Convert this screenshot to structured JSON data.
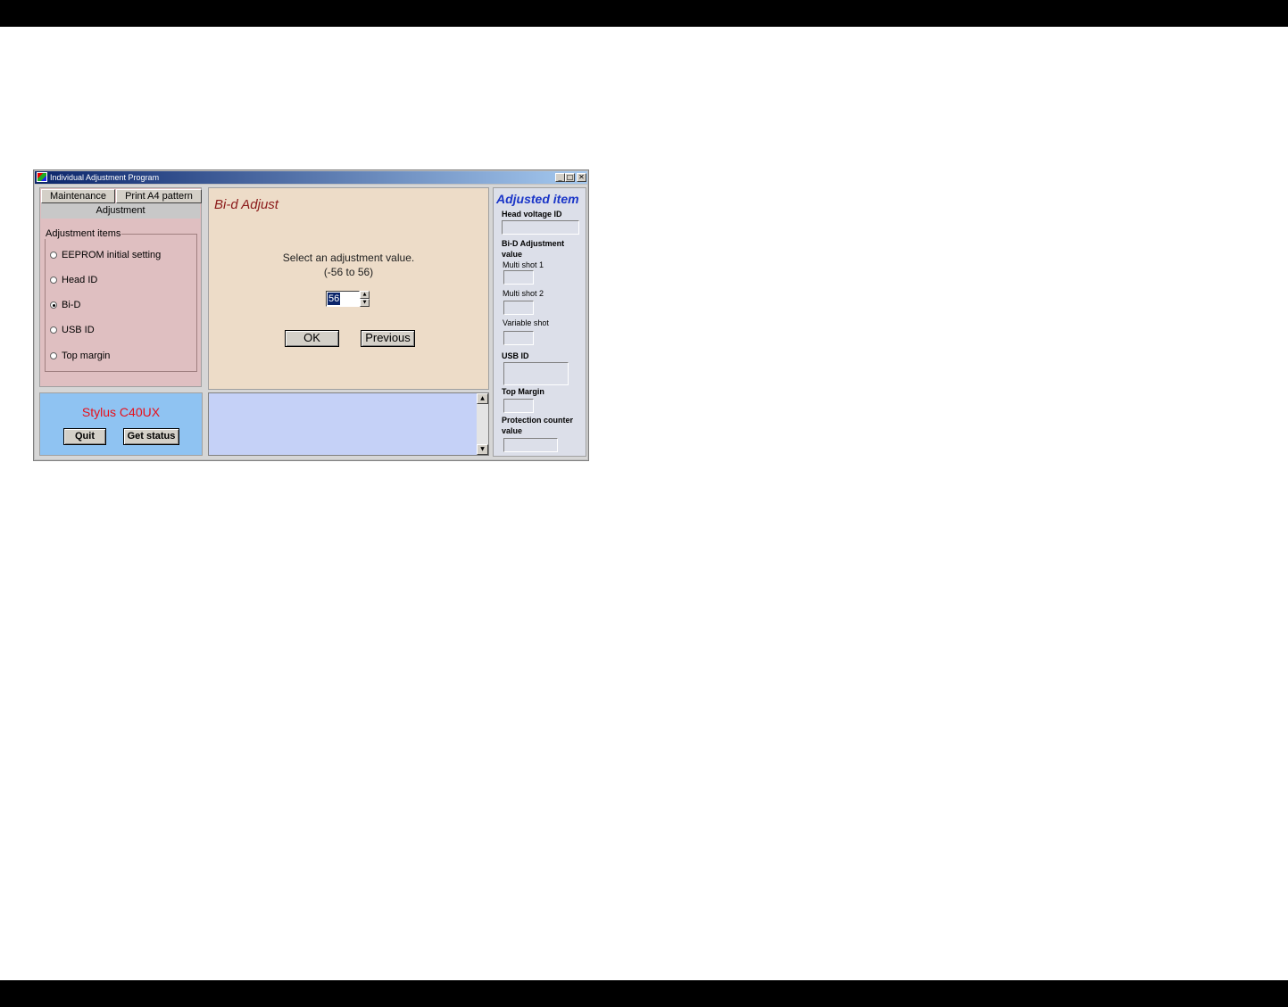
{
  "window": {
    "title": "Individual Adjustment Program",
    "controls": {
      "minimize": "_",
      "maximize": "□",
      "close": "✕"
    }
  },
  "tabs": {
    "maintenance": "Maintenance",
    "print_a4": "Print A4 pattern",
    "adjustment": "Adjustment"
  },
  "adjustment_items": {
    "label": "Adjustment items",
    "options": [
      "EEPROM initial setting",
      "Head ID",
      "Bi-D",
      "USB ID",
      "Top margin"
    ],
    "selected": "Bi-D"
  },
  "main": {
    "heading": "Bi-d Adjust",
    "prompt_line1": "Select an adjustment value.",
    "prompt_line2": "(-56 to 56)",
    "spin_value": "56",
    "ok_label": "OK",
    "previous_label": "Previous"
  },
  "adjusted": {
    "title": "Adjusted item",
    "head_voltage_id": "Head voltage ID",
    "bid_adjustment_value_1": "Bi-D Adjustment",
    "bid_adjustment_value_2": "value",
    "multi_shot_1": "Multi shot 1",
    "multi_shot_2": "Multi shot 2",
    "variable_shot": "Variable shot",
    "usb_id": "USB ID",
    "top_margin": "Top Margin",
    "protection_counter_1": "Protection counter",
    "protection_counter_2": "value"
  },
  "status": {
    "model": "Stylus C40UX",
    "quit_label": "Quit",
    "get_status_label": "Get status"
  },
  "icons": {
    "spin_up": "▲",
    "spin_down": "▼",
    "scroll_up": "▲",
    "scroll_down": "▼"
  },
  "colors": {
    "title_accent": "#8b1a1a",
    "adjusted_title": "#1a35c8",
    "model_text": "#e8101a",
    "left_panel": "#dfbfc1",
    "center_panel": "#eddcc8",
    "right_panel": "#dcdfe9",
    "status_panel": "#8fc3f2",
    "log_panel": "#c5d1f7"
  }
}
